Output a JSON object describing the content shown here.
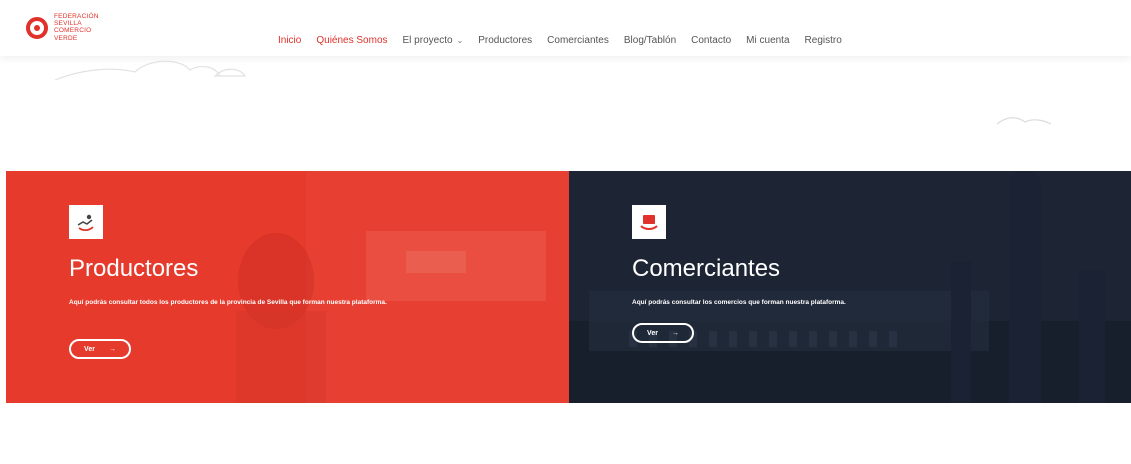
{
  "header": {
    "logo_lines": [
      "Federación",
      "Sevilla",
      "Comercio",
      "Verde"
    ],
    "nav": [
      {
        "label": "Inicio",
        "active": true
      },
      {
        "label": "Quiénes Somos",
        "active": false
      },
      {
        "label": "El proyecto",
        "active": false,
        "has_caret": true
      },
      {
        "label": "Productores",
        "active": false
      },
      {
        "label": "Comerciantes",
        "active": false
      },
      {
        "label": "Blog/Tablón",
        "active": false
      },
      {
        "label": "Contacto",
        "active": false
      },
      {
        "label": "Mi cuenta",
        "active": false
      },
      {
        "label": "Registro",
        "active": false
      }
    ]
  },
  "cards": {
    "productores": {
      "title": "Productores",
      "description": "Aquí podrás consultar todos los productores de la provincia de Sevilla que forman nuestra plataforma.",
      "button_label": "Ver",
      "button_arrow": "→",
      "icon": "producer-icon"
    },
    "comerciantes": {
      "title": "Comerciantes",
      "description": "Aquí podrás consultar los comercios que forman nuestra plataforma.",
      "button_label": "Ver",
      "button_arrow": "→",
      "icon": "shop-icon"
    }
  },
  "colors": {
    "brand_red": "#e0312a",
    "card_red": "#e63a2c",
    "card_navy": "#1d2535"
  }
}
